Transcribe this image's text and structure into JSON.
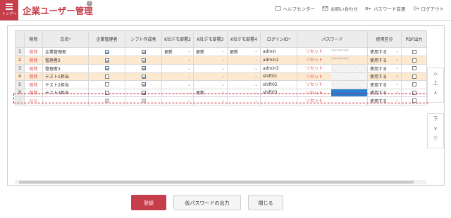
{
  "app": {
    "menu_label": "トップへ",
    "title": "企業ユーザー管理",
    "help": "?"
  },
  "topnav": [
    {
      "icon": "book-icon",
      "label": "ヘルプセンター"
    },
    {
      "icon": "mail-icon",
      "label": "お問い合わせ"
    },
    {
      "icon": "key-icon",
      "label": "パスワード変更"
    },
    {
      "icon": "logout-icon",
      "label": "ログアウト"
    }
  ],
  "table": {
    "headers": {
      "delete": "削除",
      "name": "氏名",
      "company_admin": "企業管理者",
      "shift_creator": "シフト作成者",
      "dept2": "K社デモ部署2",
      "dept3": "K社デモ部署3",
      "dept4": "K社デモ部署4",
      "login": "ログインID",
      "password": "パスワード",
      "usage": "使用区分",
      "pdf": "PDF出力",
      "required_mark": "*"
    },
    "rows": [
      {
        "no": "1",
        "del": "削除",
        "name": "企業管理者",
        "admin": true,
        "shift": true,
        "d2": "更新",
        "d3": "更新",
        "d4": "更新",
        "login": "admin",
        "reset": "リセット",
        "pw": "**********",
        "usage": "使用する",
        "pdf": false
      },
      {
        "no": "2",
        "del": "削除",
        "name": "管理者2",
        "admin": true,
        "shift": true,
        "d2": "",
        "d3": "",
        "d4": "",
        "login": "admin2",
        "reset": "リセット",
        "pw": "**********",
        "usage": "使用する",
        "pdf": false
      },
      {
        "no": "3",
        "del": "削除",
        "name": "管理者3",
        "admin": true,
        "shift": true,
        "d2": "",
        "d3": "",
        "d4": "",
        "login": "admin3",
        "reset": "リセット",
        "pw": "",
        "usage": "使用する",
        "pdf": false
      },
      {
        "no": "4",
        "del": "削除",
        "name": "テスト1担当",
        "admin": false,
        "shift": true,
        "d2": "",
        "d3": "",
        "d4": "",
        "login": "shift01",
        "reset": "リセット",
        "pw": "",
        "usage": "使用する",
        "pdf": false
      },
      {
        "no": "5",
        "del": "削除",
        "name": "テスト2担当",
        "admin": false,
        "shift": true,
        "d2": "",
        "d3": "",
        "d4": "",
        "login": "shift02",
        "reset": "リセット",
        "pw": "",
        "usage": "使用する",
        "pdf": false
      },
      {
        "no": "6",
        "del": "削除",
        "name": "テスト3担当",
        "admin": false,
        "shift": true,
        "d2": "",
        "d3": "更新",
        "d4": "",
        "login": "shift03",
        "reset": "リセット",
        "pw": "",
        "usage": "使用する",
        "pdf": false
      },
      {
        "no": "7",
        "del": "削除",
        "name": "",
        "admin": false,
        "shift": false,
        "d2": "",
        "d3": "",
        "d4": "",
        "login": "",
        "reset": "リセット",
        "pw": "",
        "usage": "使用する",
        "pdf": false
      }
    ]
  },
  "side_top": [
    "△",
    "上",
    "∧"
  ],
  "side_bottom": [
    "下",
    "∨",
    "▽"
  ],
  "buttons": {
    "register": "登録",
    "temp_password": "仮パスワードの出力",
    "close": "閉じる"
  },
  "colors": {
    "brand": "#c63d4b",
    "highlight_row": "#fde8d0",
    "selection_dash": "#c9182d",
    "password_selected": "#2a7fd0"
  }
}
